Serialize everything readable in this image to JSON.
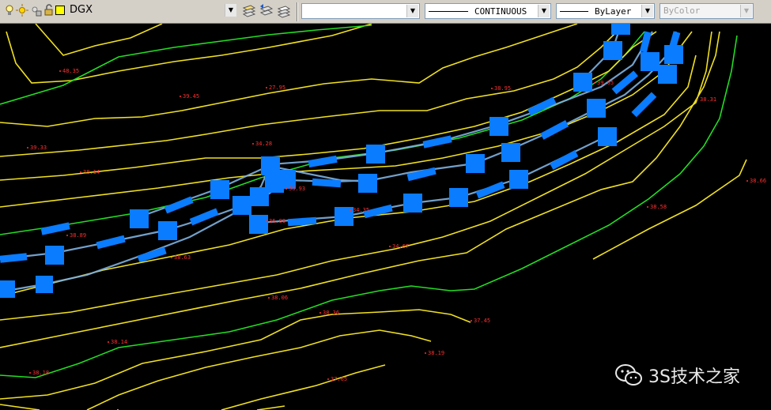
{
  "toolbar": {
    "layer_name": "DGX",
    "layer_color": "#ffff00",
    "layer_icons": [
      "lightbulb-icon",
      "sun-icon",
      "freeze-viewport-icon",
      "lock-icon",
      "color-swatch-icon"
    ],
    "buttons": [
      "make-layer-current-icon",
      "layer-previous-icon",
      "layer-states-icon"
    ],
    "combo_blank": "",
    "linetype": "CONTINUOUS",
    "lineweight": "ByLayer",
    "plotstyle": "ByColor"
  },
  "drawing": {
    "background": "#000000",
    "colors": {
      "contour_minor": "#f0e020",
      "contour_major": "#22dd22",
      "grip": "#0a7cff",
      "label": "#ff3030"
    },
    "elevation_labels": [
      "48.35",
      "39.45",
      "27.95",
      "38.95",
      "39.65",
      "38.31",
      "39.33",
      "38.14",
      "34.28",
      "38.66",
      "38.58",
      "34.35",
      "38.89",
      "38.63",
      "36.89",
      "34.67",
      "38.06",
      "38.36",
      "37.45",
      "38.14",
      "38.19",
      "38.18",
      "37.65",
      "38.93"
    ]
  },
  "watermark": {
    "icon": "wechat-icon",
    "text": "3S技术之家"
  }
}
